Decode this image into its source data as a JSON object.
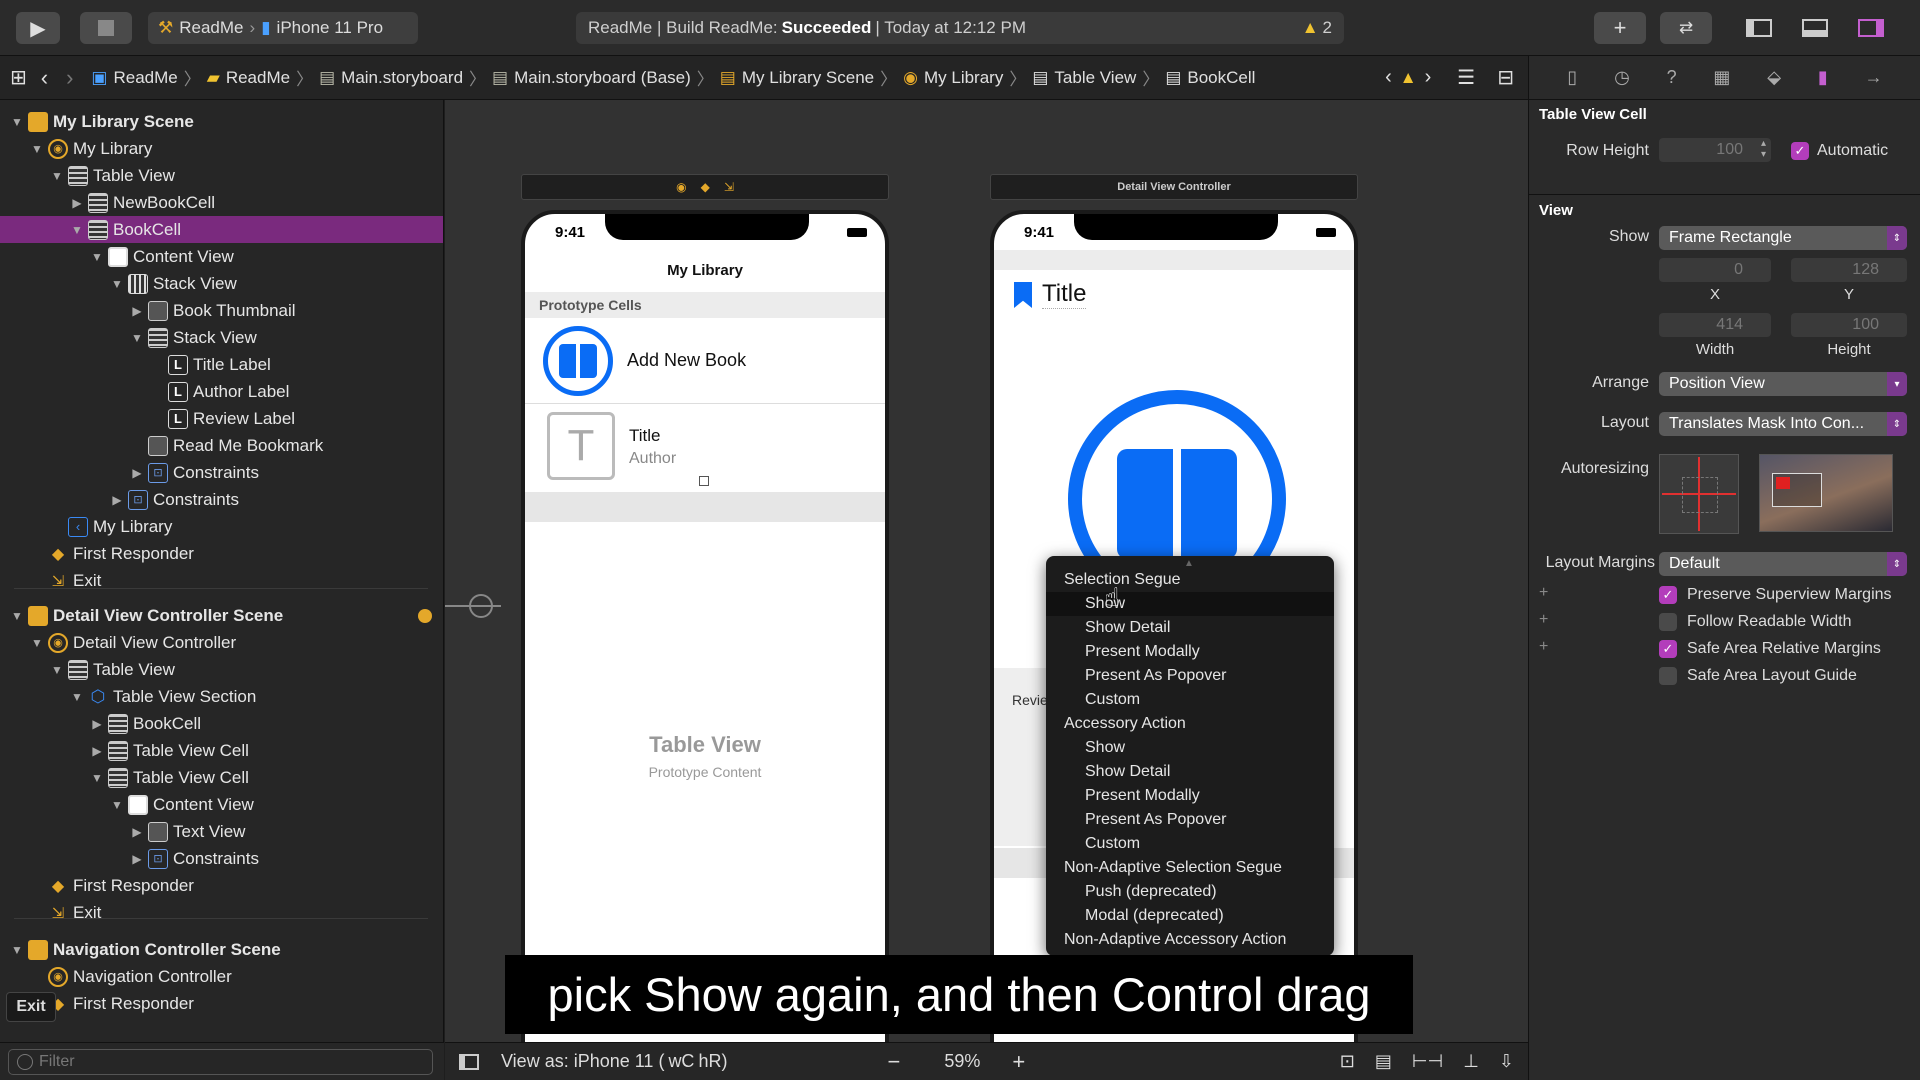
{
  "toolbar": {
    "scheme_target": "ReadMe",
    "scheme_device": "iPhone 11 Pro",
    "status_prefix": "ReadMe | Build ReadMe:",
    "status_result": "Succeeded",
    "status_time": "| Today at 12:12 PM",
    "warning_count": "2"
  },
  "jumpbar": {
    "crumbs": [
      "ReadMe",
      "ReadMe",
      "Main.storyboard",
      "Main.storyboard (Base)",
      "My Library Scene",
      "My Library",
      "Table View",
      "BookCell"
    ]
  },
  "navigator": {
    "rows": [
      {
        "label": "My Library Scene",
        "icon": "scene-icon"
      },
      {
        "label": "My Library",
        "icon": "controller-icon"
      },
      {
        "label": "Table View",
        "icon": "table-icon"
      },
      {
        "label": "NewBookCell",
        "icon": "table-icon"
      },
      {
        "label": "BookCell",
        "icon": "table-icon"
      },
      {
        "label": "Content View",
        "icon": "view-icon"
      },
      {
        "label": "Stack View",
        "icon": "stack-icon"
      },
      {
        "label": "Book Thumbnail",
        "icon": "image-icon"
      },
      {
        "label": "Stack View",
        "icon": "table-icon"
      },
      {
        "label": "Title Label",
        "icon": "label-icon"
      },
      {
        "label": "Author Label",
        "icon": "label-icon"
      },
      {
        "label": "Review Label",
        "icon": "label-icon"
      },
      {
        "label": "Read Me Bookmark",
        "icon": "image-icon"
      },
      {
        "label": "Constraints",
        "icon": "constraints-icon"
      },
      {
        "label": "Constraints",
        "icon": "constraints-icon"
      },
      {
        "label": "My Library",
        "icon": "nav-item-icon"
      },
      {
        "label": "First Responder",
        "icon": "responder-icon"
      },
      {
        "label": "Exit",
        "icon": "exit-icon"
      },
      {
        "label": "Detail View Controller Scene",
        "icon": "scene-icon"
      },
      {
        "label": "Detail View Controller",
        "icon": "controller-icon"
      },
      {
        "label": "Table View",
        "icon": "table-icon"
      },
      {
        "label": "Table View Section",
        "icon": "section-icon"
      },
      {
        "label": "BookCell",
        "icon": "table-icon"
      },
      {
        "label": "Table View Cell",
        "icon": "table-icon"
      },
      {
        "label": "Table View Cell",
        "icon": "table-icon"
      },
      {
        "label": "Content View",
        "icon": "view-icon"
      },
      {
        "label": "Text View",
        "icon": "image-icon"
      },
      {
        "label": "Constraints",
        "icon": "constraints-icon"
      },
      {
        "label": "First Responder",
        "icon": "responder-icon"
      },
      {
        "label": "Exit",
        "icon": "exit-icon"
      },
      {
        "label": "Navigation Controller Scene",
        "icon": "scene-icon"
      },
      {
        "label": "Navigation Controller",
        "icon": "controller-icon"
      },
      {
        "label": "First Responder",
        "icon": "responder-icon"
      }
    ],
    "tooltip": "Exit",
    "filter_placeholder": "Filter"
  },
  "canvas": {
    "library_phone": {
      "time": "9:41",
      "nav_title": "My Library",
      "section_header": "Prototype Cells",
      "cell1_label": "Add New Book",
      "cell2_title": "Title",
      "cell2_author": "Author",
      "cell2_thumb": "T",
      "placeholder_title": "Table View",
      "placeholder_sub": "Prototype Content"
    },
    "detail_phone": {
      "header": "Detail View Controller",
      "time": "9:41",
      "title": "Title",
      "review_fragment": "Revie"
    },
    "bottom_bar": {
      "view_as": "View as: iPhone 11 (",
      "size_class_w": "wC",
      "size_class_h": "hR)",
      "zoom": "59%"
    }
  },
  "segue_menu": {
    "items": [
      {
        "label": "Selection Segue",
        "type": "header"
      },
      {
        "label": "Show",
        "type": "item",
        "highlight": true
      },
      {
        "label": "Show Detail",
        "type": "item"
      },
      {
        "label": "Present Modally",
        "type": "item"
      },
      {
        "label": "Present As Popover",
        "type": "item"
      },
      {
        "label": "Custom",
        "type": "item"
      },
      {
        "label": "Accessory Action",
        "type": "header"
      },
      {
        "label": "Show",
        "type": "item"
      },
      {
        "label": "Show Detail",
        "type": "item"
      },
      {
        "label": "Present Modally",
        "type": "item"
      },
      {
        "label": "Present As Popover",
        "type": "item"
      },
      {
        "label": "Custom",
        "type": "item"
      },
      {
        "label": "Non-Adaptive Selection Segue",
        "type": "header"
      },
      {
        "label": "Push (deprecated)",
        "type": "item"
      },
      {
        "label": "Modal (deprecated)",
        "type": "item"
      },
      {
        "label": "Non-Adaptive Accessory Action",
        "type": "header"
      }
    ]
  },
  "inspector": {
    "section_cell": "Table View Cell",
    "row_height_label": "Row Height",
    "row_height_value": "100",
    "automatic_label": "Automatic",
    "section_view": "View",
    "show_label": "Show",
    "show_value": "Frame Rectangle",
    "x_value": "0",
    "y_value": "128",
    "x_label": "X",
    "y_label": "Y",
    "width_value": "414",
    "height_value": "100",
    "width_label": "Width",
    "height_label": "Height",
    "arrange_label": "Arrange",
    "arrange_value": "Position View",
    "layout_label": "Layout",
    "layout_value": "Translates Mask Into Con...",
    "autoresizing_label": "Autoresizing",
    "layout_margins_label": "Layout Margins",
    "layout_margins_value": "Default",
    "checks": [
      {
        "label": "Preserve Superview Margins",
        "checked": true
      },
      {
        "label": "Follow Readable Width",
        "checked": false
      },
      {
        "label": "Safe Area Relative Margins",
        "checked": true
      },
      {
        "label": "Safe Area Layout Guide",
        "checked": false
      }
    ]
  },
  "caption": "pick Show again, and then Control drag",
  "colors": {
    "accent": "#b33dbb",
    "selection": "#7a2a7e",
    "ios_blue": "#0a6cf5",
    "warning": "#f0c330"
  }
}
